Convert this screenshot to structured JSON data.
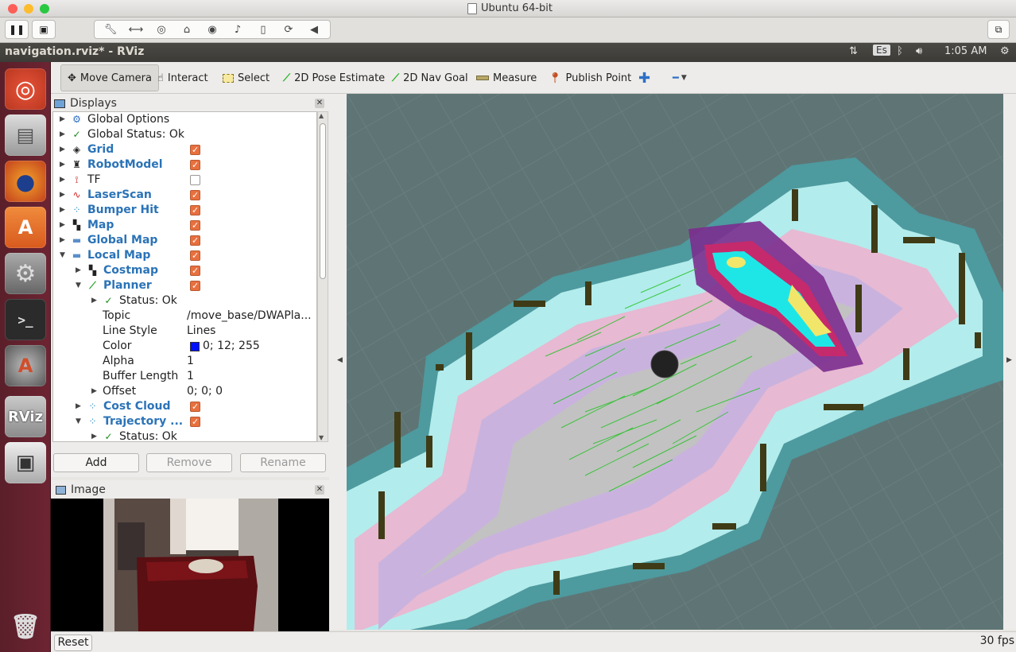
{
  "vm": {
    "title": "Ubuntu 64-bit"
  },
  "topbar": {
    "window_title": "navigation.rviz* - RViz",
    "keyboard": "Es",
    "time": "1:05 AM"
  },
  "toolbar": {
    "move_camera": "Move Camera",
    "interact": "Interact",
    "select": "Select",
    "pose_estimate": "2D Pose Estimate",
    "nav_goal": "2D Nav Goal",
    "measure": "Measure",
    "publish_point": "Publish Point"
  },
  "displays": {
    "title": "Displays",
    "rows": [
      {
        "label": "Global Options"
      },
      {
        "label": "Global Status: Ok"
      },
      {
        "label": "Grid"
      },
      {
        "label": "RobotModel"
      },
      {
        "label": "TF"
      },
      {
        "label": "LaserScan"
      },
      {
        "label": "Bumper Hit"
      },
      {
        "label": "Map"
      },
      {
        "label": "Global Map"
      },
      {
        "label": "Local Map"
      },
      {
        "label": "Costmap"
      },
      {
        "label": "Planner"
      },
      {
        "label": "Status: Ok"
      },
      {
        "label": "Topic",
        "value": "/move_base/DWAPla..."
      },
      {
        "label": "Line Style",
        "value": "Lines"
      },
      {
        "label": "Color",
        "value": "0; 12; 255",
        "swatch": "#0010ff"
      },
      {
        "label": "Alpha",
        "value": "1"
      },
      {
        "label": "Buffer Length",
        "value": "1"
      },
      {
        "label": "Offset",
        "value": "0; 0; 0"
      },
      {
        "label": "Cost Cloud"
      },
      {
        "label": "Trajectory ..."
      },
      {
        "label": "Status: Ok"
      }
    ],
    "add": "Add",
    "remove": "Remove",
    "rename": "Rename"
  },
  "image_panel": {
    "title": "Image"
  },
  "bottom": {
    "reset": "Reset",
    "fps": "30 fps"
  }
}
